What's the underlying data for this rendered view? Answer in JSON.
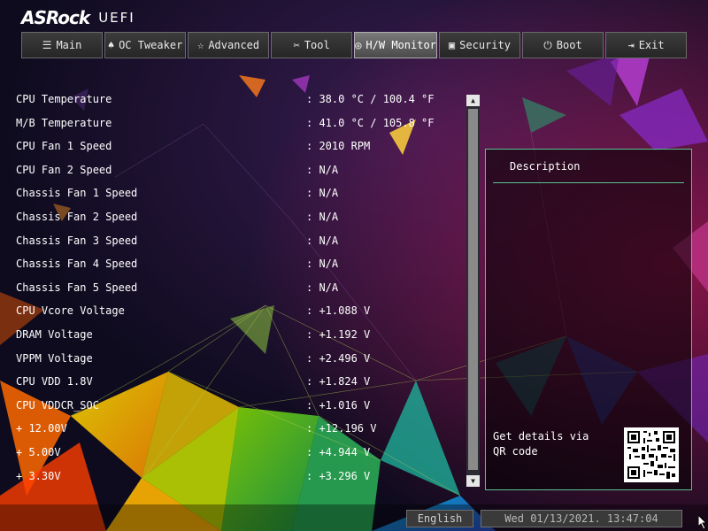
{
  "brand": {
    "logo": "ASRock",
    "product": "UEFI"
  },
  "tabs": [
    {
      "label": "Main",
      "icon": "list-icon",
      "glyph": "☰"
    },
    {
      "label": "OC Tweaker",
      "icon": "rocket-icon",
      "glyph": "♠"
    },
    {
      "label": "Advanced",
      "icon": "star-icon",
      "glyph": "☆"
    },
    {
      "label": "Tool",
      "icon": "tool-icon",
      "glyph": "✂"
    },
    {
      "label": "H/W Monitor",
      "icon": "monitor-icon",
      "glyph": "◎"
    },
    {
      "label": "Security",
      "icon": "shield-icon",
      "glyph": "▣"
    },
    {
      "label": "Boot",
      "icon": "power-icon",
      "glyph": "⏻"
    },
    {
      "label": "Exit",
      "icon": "exit-icon",
      "glyph": "⇥"
    }
  ],
  "active_tab": "H/W Monitor",
  "monitor": {
    "rows": [
      {
        "label": "CPU Temperature",
        "value": ": 38.0 °C / 100.4 °F"
      },
      {
        "label": "M/B Temperature",
        "value": ": 41.0 °C / 105.8 °F"
      },
      {
        "label": "CPU Fan 1 Speed",
        "value": ": 2010 RPM"
      },
      {
        "label": "CPU Fan 2 Speed",
        "value": ": N/A"
      },
      {
        "label": "Chassis Fan 1 Speed",
        "value": ": N/A"
      },
      {
        "label": "Chassis Fan 2 Speed",
        "value": ": N/A"
      },
      {
        "label": "Chassis Fan 3 Speed",
        "value": ": N/A"
      },
      {
        "label": "Chassis Fan 4 Speed",
        "value": ": N/A"
      },
      {
        "label": "Chassis Fan 5 Speed",
        "value": ": N/A"
      },
      {
        "label": "CPU Vcore Voltage",
        "value": ": +1.088 V"
      },
      {
        "label": "DRAM Voltage",
        "value": ": +1.192 V"
      },
      {
        "label": "VPPM Voltage",
        "value": ": +2.496 V"
      },
      {
        "label": "CPU VDD 1.8V",
        "value": ": +1.824 V"
      },
      {
        "label": "CPU VDDCR_SOC",
        "value": ": +1.016 V"
      },
      {
        "label": "+ 12.00V",
        "value": ": +12.196 V"
      },
      {
        "label": "+ 5.00V",
        "value": ": +4.944 V"
      },
      {
        "label": "+ 3.30V",
        "value": ": +3.296 V"
      }
    ]
  },
  "scrollbar": {
    "up_glyph": "▲",
    "down_glyph": "▼"
  },
  "description": {
    "title": "Description",
    "qr_text": "Get details via QR code",
    "qr_icon": "qr-code-icon"
  },
  "footer": {
    "language": "English",
    "datetime": "Wed 01/13/2021. 13:47:04"
  },
  "colors": {
    "accent": "#57c28d",
    "tab_bg": "#2e2e2e",
    "tab_active": "#6a6a6a"
  }
}
